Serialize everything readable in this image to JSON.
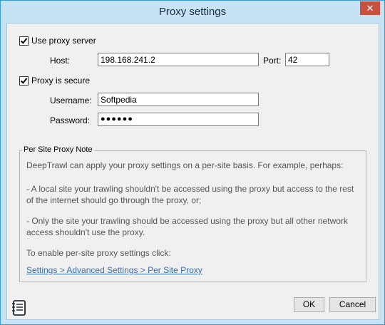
{
  "window": {
    "title": "Proxy settings",
    "close_glyph": "✕"
  },
  "proxy": {
    "use_proxy_label": "Use proxy server",
    "host_label": "Host:",
    "host_value": "198.168.241.2",
    "port_label": "Port:",
    "port_value": "42",
    "secure_label": "Proxy is secure",
    "username_label": "Username:",
    "username_value": "Softpedia",
    "password_label": "Password:",
    "password_value": "●●●●●●"
  },
  "note": {
    "group_title": "Per Site Proxy Note",
    "p1": "DeepTrawl can apply your proxy settings on a per-site basis. For example, perhaps:",
    "p2": "- A local site your trawling shouldn't be accessed using the proxy but access to the rest of the internet should go through the proxy, or;",
    "p3": "- Only the site your trawling should be accessed using the proxy but all other network access shouldn't use the proxy.",
    "p4": "To enable per-site proxy settings click:",
    "link": "Settings > Advanced Settings > Per Site Proxy"
  },
  "buttons": {
    "ok": "OK",
    "cancel": "Cancel"
  },
  "icons": {
    "app": "notebook-icon",
    "close": "close-icon"
  }
}
